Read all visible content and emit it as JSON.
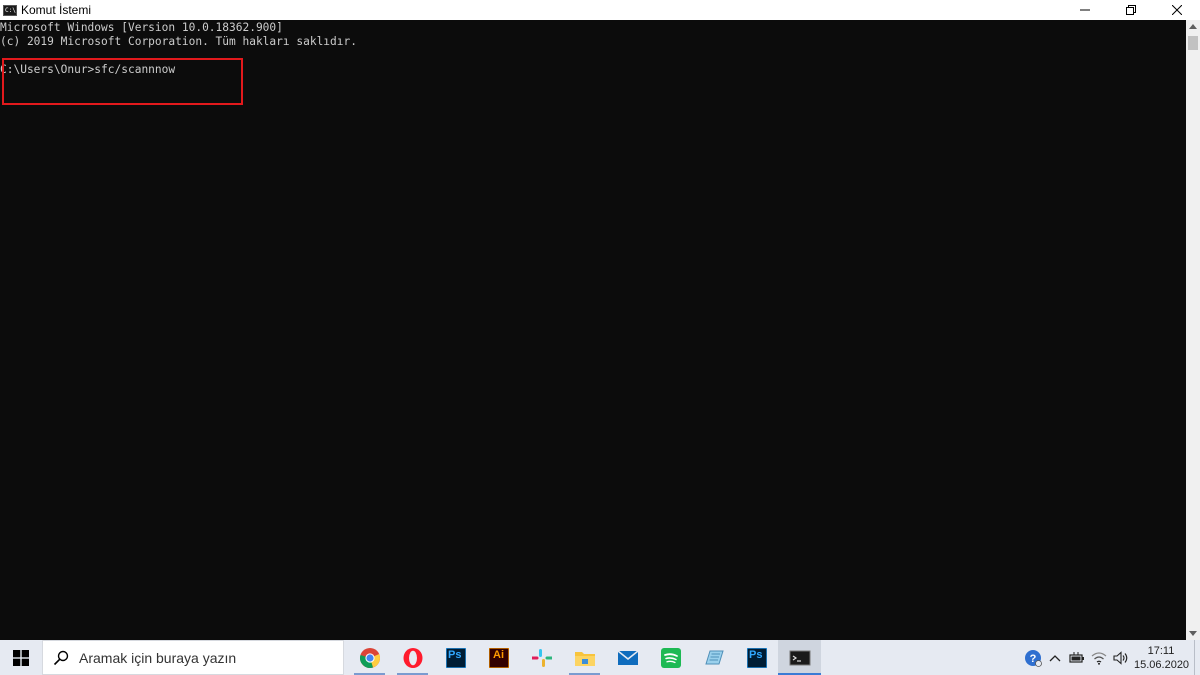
{
  "window": {
    "title": "Komut İstemi",
    "icon_name": "cmd-app-icon",
    "icon_glyph": "C:\\"
  },
  "console": {
    "lines": [
      "Microsoft Windows [Version 10.0.18362.900]",
      "(c) 2019 Microsoft Corporation. Tüm hakları saklıdır.",
      "",
      "C:\\Users\\Onur>sfc/scannnow"
    ],
    "highlight_color": "#e3191c"
  },
  "taskbar": {
    "search_placeholder": "Aramak için buraya yazın",
    "apps": [
      {
        "name": "chrome",
        "label": ""
      },
      {
        "name": "opera",
        "label": ""
      },
      {
        "name": "photoshop",
        "label": "Ps"
      },
      {
        "name": "illustrator",
        "label": "Ai"
      },
      {
        "name": "slack",
        "label": ""
      },
      {
        "name": "file-explorer",
        "label": ""
      },
      {
        "name": "mail",
        "label": ""
      },
      {
        "name": "spotify",
        "label": ""
      },
      {
        "name": "notepad",
        "label": ""
      },
      {
        "name": "photoshop-2",
        "label": "Ps"
      },
      {
        "name": "command-prompt",
        "label": ""
      }
    ],
    "clock": {
      "time": "17:11",
      "date": "15.06.2020"
    }
  },
  "colors": {
    "console_bg": "#0c0c0c",
    "console_text": "#cccccc",
    "taskbar_bg": "#e6eaf2",
    "ps_blue": "#001d34",
    "ai_orange": "#330000"
  }
}
